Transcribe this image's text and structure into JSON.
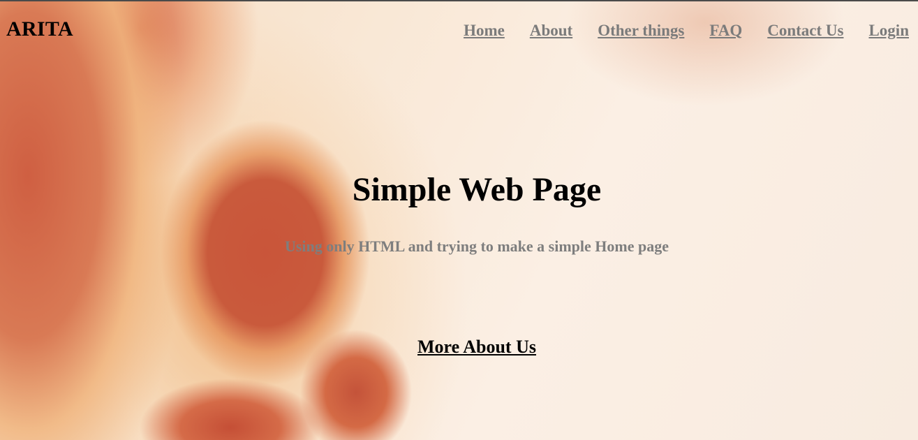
{
  "brand": {
    "logo_text": "ARITA"
  },
  "nav": {
    "items": [
      {
        "label": "Home"
      },
      {
        "label": "About"
      },
      {
        "label": "Other things"
      },
      {
        "label": "FAQ"
      },
      {
        "label": "Contact Us"
      },
      {
        "label": "Login"
      }
    ]
  },
  "hero": {
    "title": "Simple Web Page",
    "subtitle": "Using only HTML and trying to make a simple Home page",
    "cta_label": "More About Us"
  },
  "colors": {
    "nav_link": "#7b7b7b",
    "subtitle": "#7e7e7e",
    "text": "#000000",
    "background_accent": "#c9553a"
  }
}
